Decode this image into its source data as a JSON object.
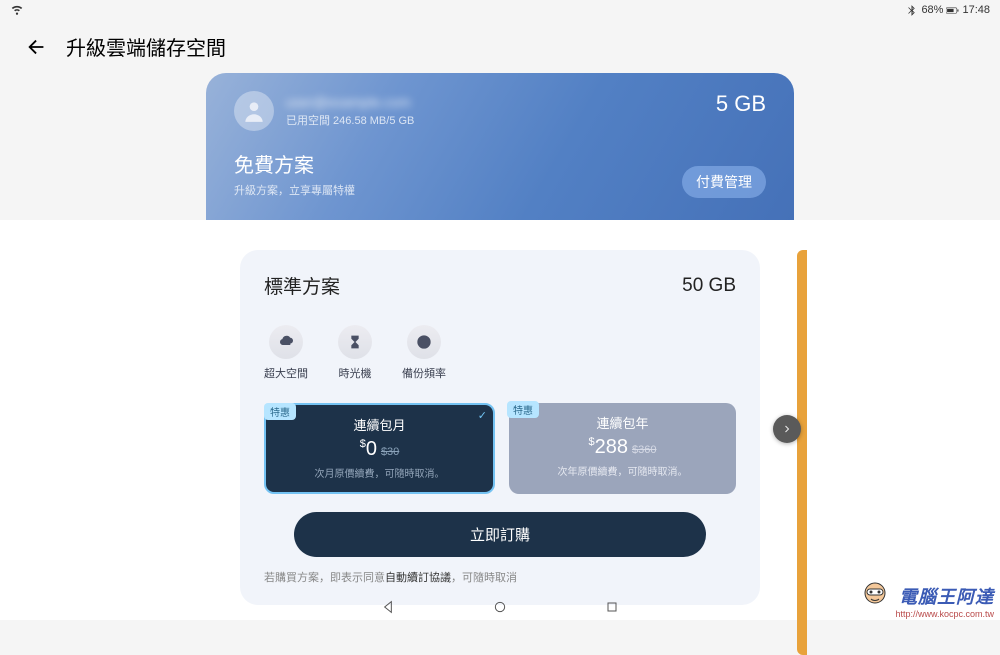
{
  "status": {
    "battery": "68%",
    "time": "17:48"
  },
  "page_title": "升級雲端儲存空間",
  "hero": {
    "user_name_blurred": "user@example.com",
    "usage": "已用空間 246.58 MB/5 GB",
    "quota": "5 GB",
    "plan_title": "免費方案",
    "plan_sub": "升級方案，立享專屬特權",
    "pay_manage": "付費管理"
  },
  "plan": {
    "title": "標準方案",
    "quota": "50 GB",
    "features": [
      {
        "label": "超大空間",
        "icon": "cloud"
      },
      {
        "label": "時光機",
        "icon": "hourglass"
      },
      {
        "label": "備份頻率",
        "icon": "dollar"
      }
    ],
    "options": [
      {
        "deal": "特惠",
        "name": "連續包月",
        "currency": "$",
        "price": "0",
        "old": "$30",
        "note": "次月原價續費，可隨時取消。",
        "selected": true
      },
      {
        "deal": "特惠",
        "name": "連續包年",
        "currency": "$",
        "price": "288",
        "old": "$360",
        "note": "次年原價續費，可隨時取消。",
        "selected": false
      }
    ],
    "subscribe": "立即訂購",
    "agreement_pre": "若購買方案，即表示同意",
    "agreement_bold": "自動續訂協議",
    "agreement_post": "，可隨時取消"
  },
  "watermark": {
    "brand": "電腦王阿達",
    "url": "http://www.kocpc.com.tw"
  }
}
